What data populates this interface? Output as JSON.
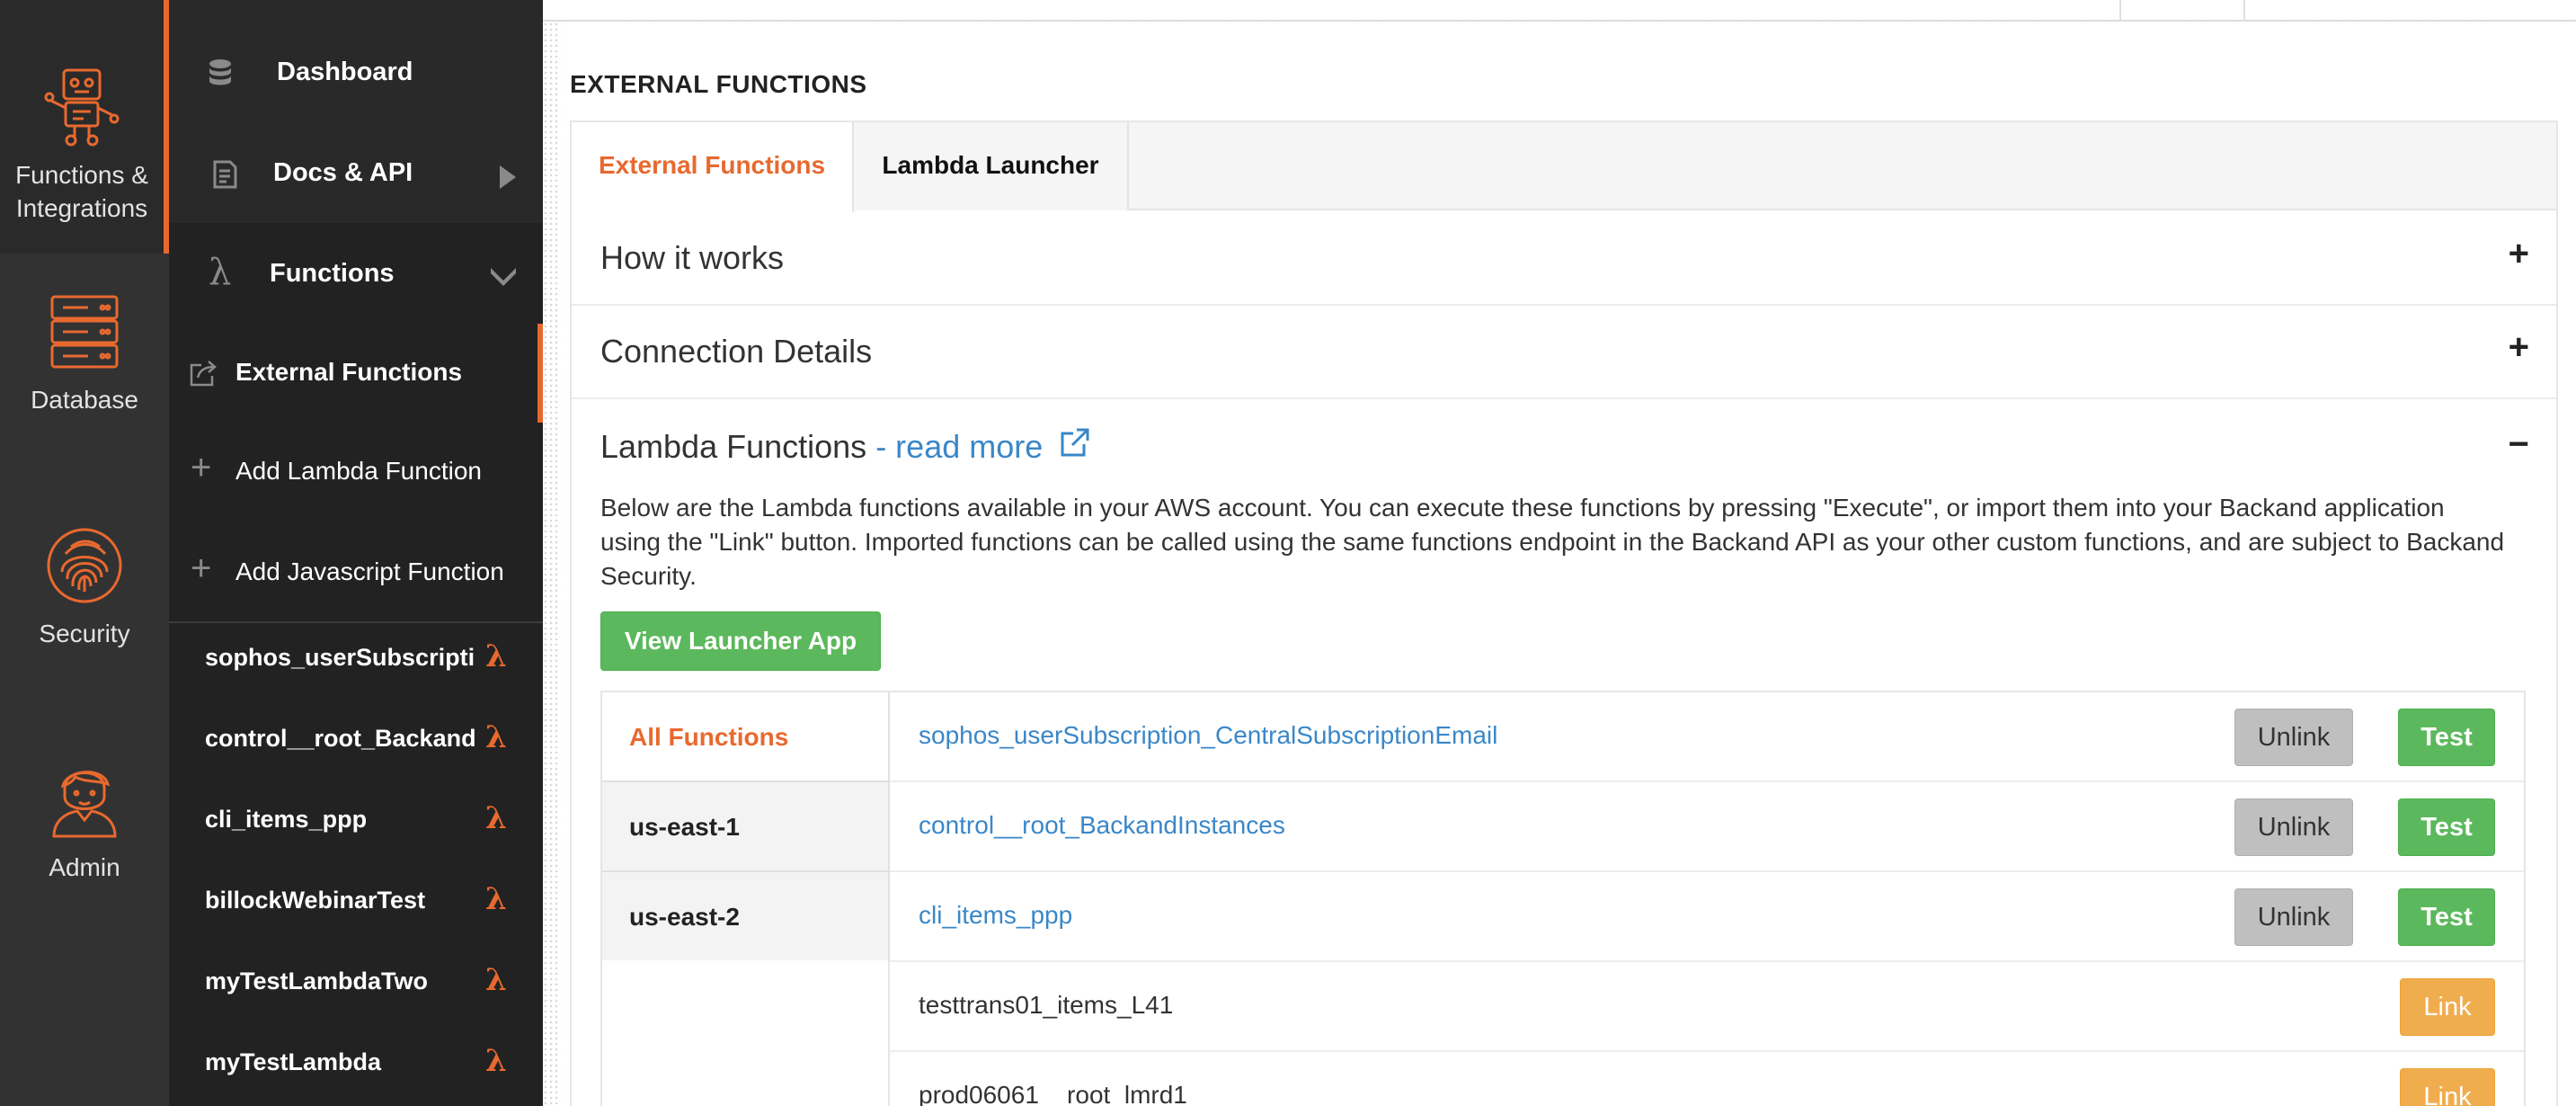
{
  "rail": {
    "items": [
      {
        "label_line1": "Functions &",
        "label_line2": "Integrations",
        "icon": "robot-icon",
        "active": true
      },
      {
        "label": "Database",
        "icon": "server-icon"
      },
      {
        "label": "Security",
        "icon": "fingerprint-icon"
      },
      {
        "label": "Admin",
        "icon": "admin-user-icon"
      }
    ]
  },
  "menu": {
    "dashboard": "Dashboard",
    "docs": "Docs & API",
    "functions": "Functions",
    "external_functions": "External Functions",
    "add_lambda": "Add Lambda Function",
    "add_javascript": "Add Javascript Function",
    "function_list": [
      "sophos_userSubscripti",
      "control__root_Backandl",
      "cli_items_ppp",
      "billockWebinarTest",
      "myTestLambdaTwo",
      "myTestLambda"
    ],
    "lambda_symbol": "λ"
  },
  "page": {
    "title": "EXTERNAL FUNCTIONS",
    "tabs": [
      "External Functions",
      "Lambda Launcher"
    ],
    "accordion": {
      "how_it_works": "How it works",
      "connection_details": "Connection Details",
      "lambda_functions": "Lambda Functions",
      "read_more": " - read more",
      "expand_symbol": "+",
      "collapse_symbol": "−"
    },
    "description": "Below are the Lambda functions available in your AWS account. You can execute these functions by pressing \"Execute\", or import them into your Backand application using the \"Link\" button. Imported functions can be called using the same functions endpoint in the Backand API as your other custom functions, and are subject to Backand Security.",
    "view_launcher_button": "View Launcher App",
    "regions": [
      "All Functions",
      "us-east-1",
      "us-east-2"
    ],
    "functions": [
      {
        "name": "sophos_userSubscription_CentralSubscriptionEmail",
        "linked": true
      },
      {
        "name": "control__root_BackandInstances",
        "linked": true
      },
      {
        "name": "cli_items_ppp",
        "linked": true
      },
      {
        "name": "testtrans01_items_L41",
        "linked": false
      },
      {
        "name": "prod06061__root_lmrd1",
        "linked": false
      }
    ],
    "buttons": {
      "unlink": "Unlink",
      "test": "Test",
      "link": "Link"
    }
  },
  "colors": {
    "accent": "#e8692f",
    "link": "#3a87c8",
    "success": "#5cb85c",
    "warning": "#f0ad4e",
    "rail_bg": "#323232",
    "menu_bg": "#222222"
  }
}
